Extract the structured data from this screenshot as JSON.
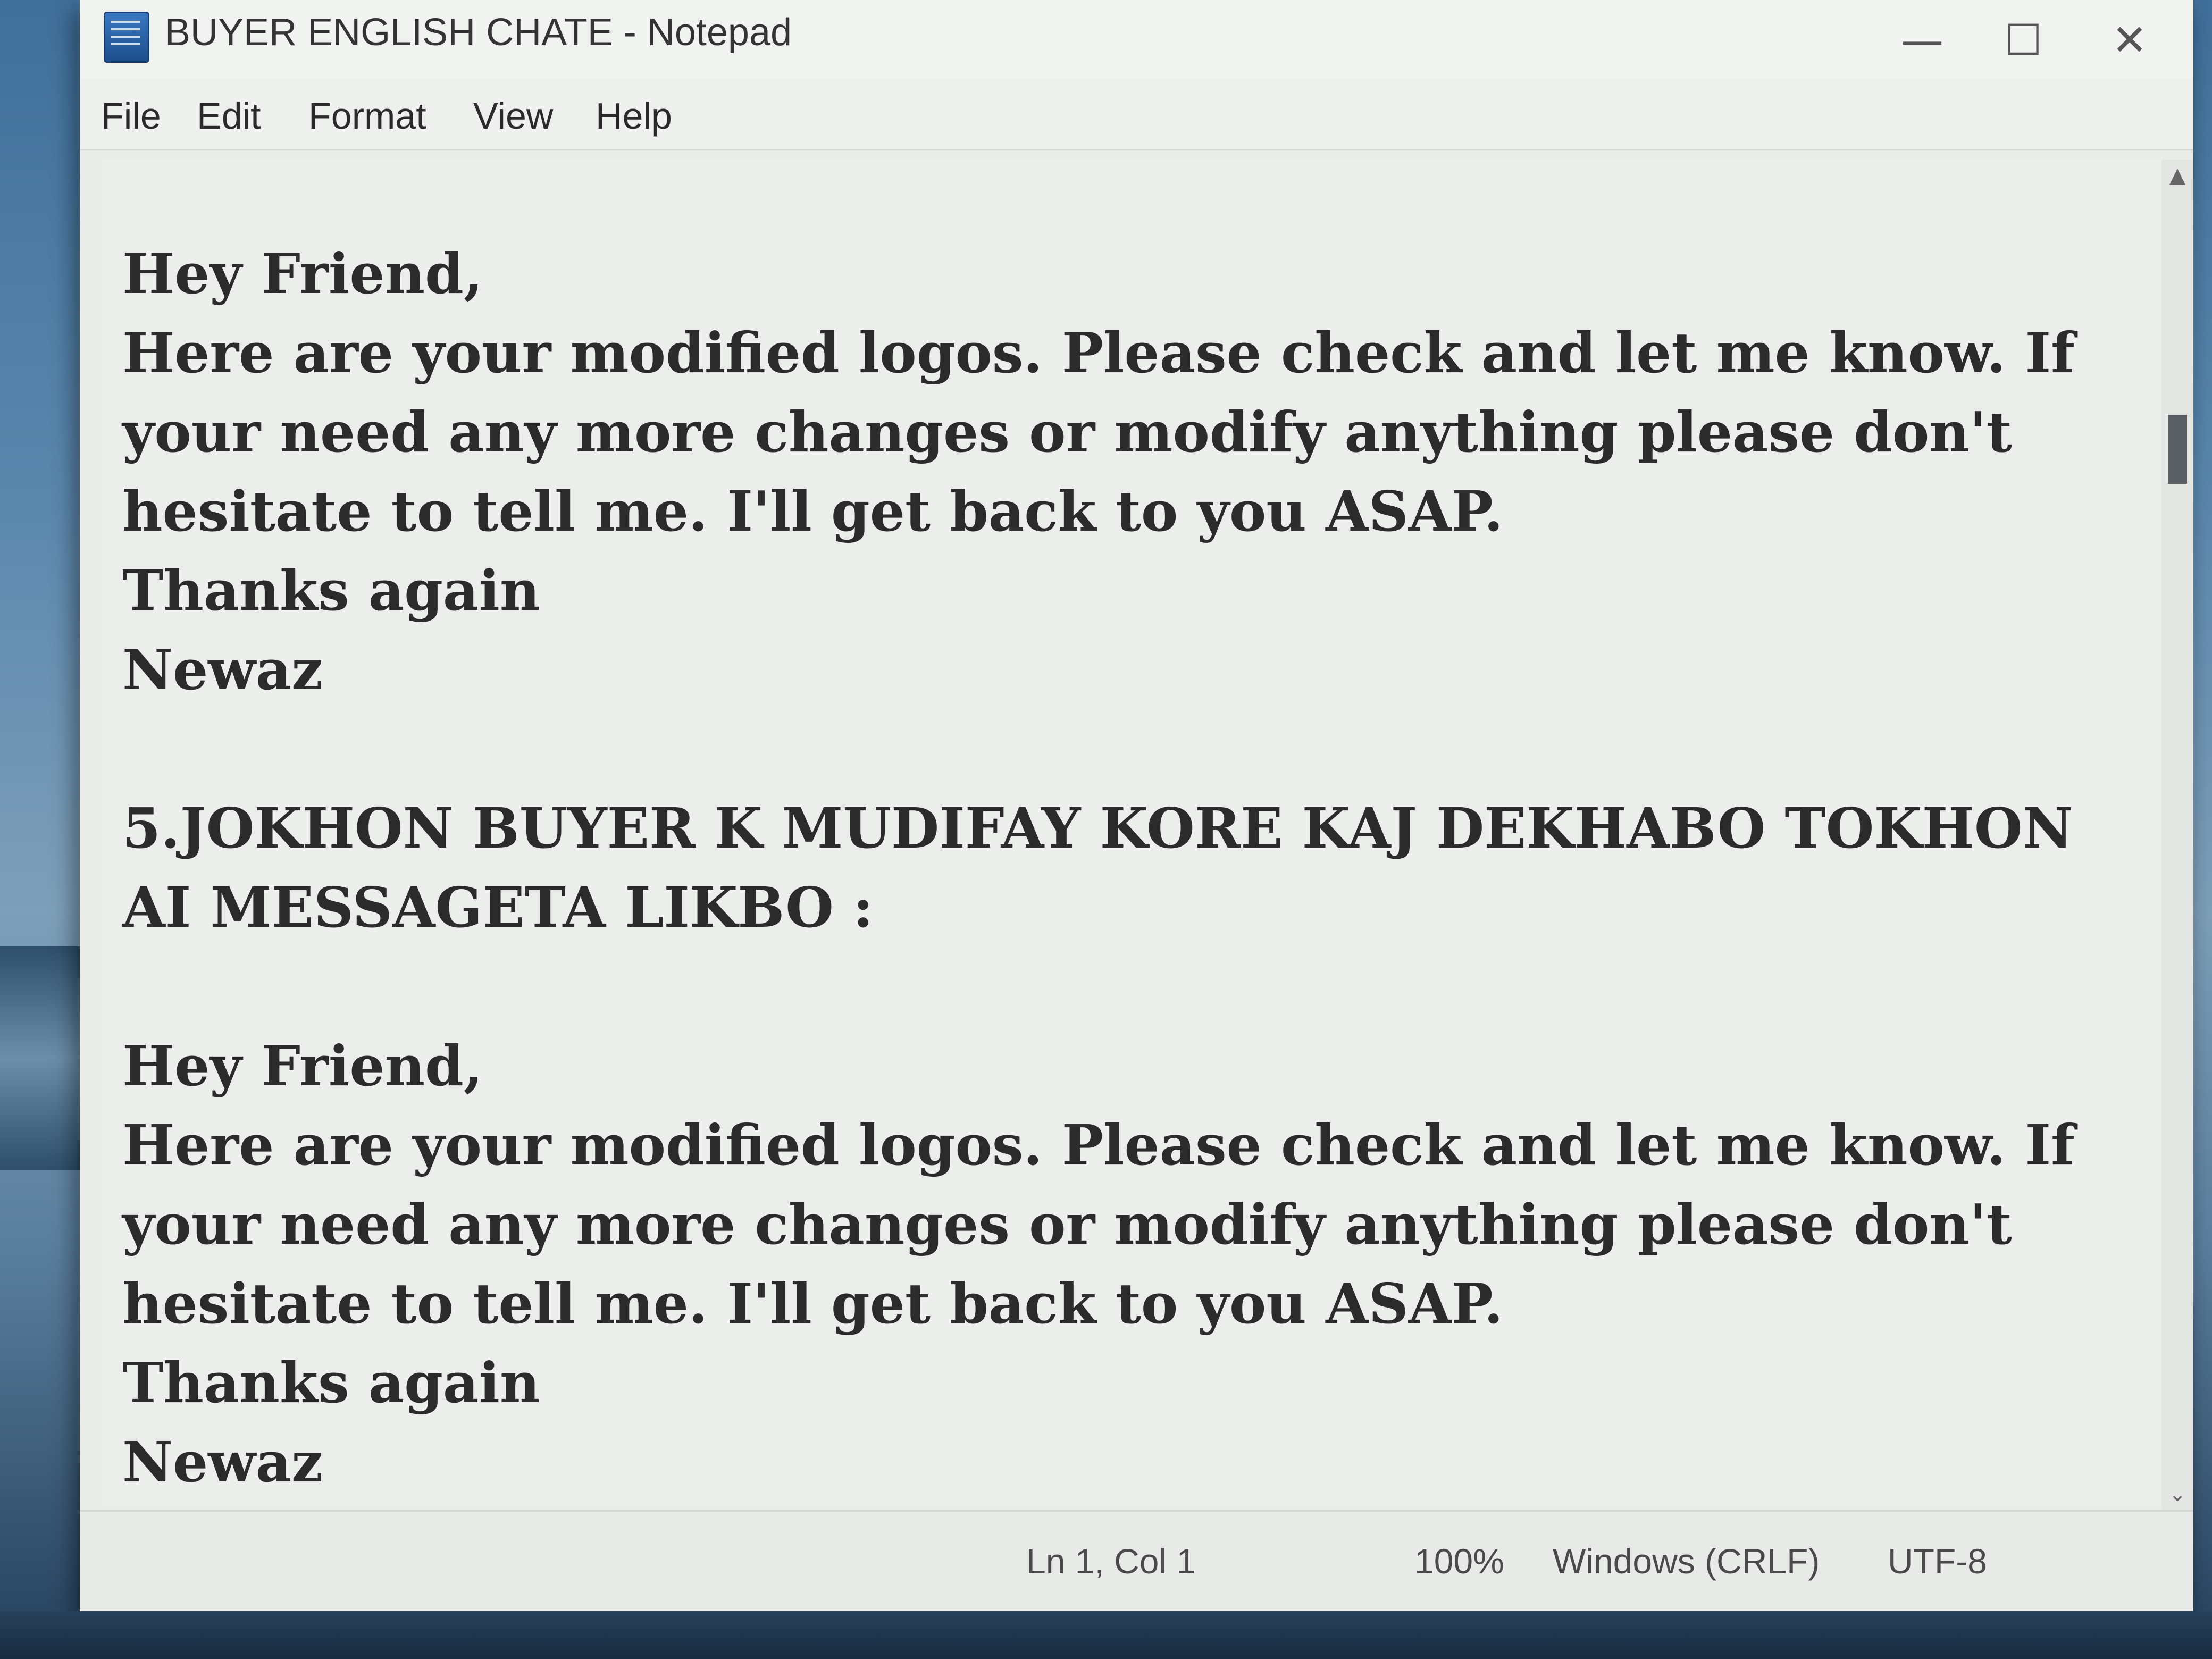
{
  "window": {
    "title": "BUYER ENGLISH CHATE - Notepad",
    "minimize_glyph": "—",
    "maximize_glyph": "☐",
    "close_glyph": "✕"
  },
  "menu": {
    "file": "File",
    "edit": "Edit",
    "format": "Format",
    "view": "View",
    "help": "Help"
  },
  "editor": {
    "text": "Hey Friend,\nHere are your modified logos. Please check and let me know. If your need any more changes or modify anything please don't hesitate to tell me. I'll get back to you ASAP.\nThanks again\nNewaz\n\n5.JOKHON BUYER K MUDIFAY KORE KAJ DEKHABO TOKHON AI MESSAGETA LIKBO :\n\nHey Friend,\nHere are your modified logos. Please check and let me know. If your need any more changes or modify anything please don't hesitate to tell me. I'll get back to you ASAP.\nThanks again\nNewaz"
  },
  "status": {
    "position": "Ln 1, Col 1",
    "zoom": "100%",
    "line_ending": "Windows (CRLF)",
    "encoding": "UTF-8"
  },
  "icons": {
    "app": "notepad-icon",
    "scroll_up": "chevron-up-icon",
    "scroll_down": "chevron-down-icon"
  }
}
